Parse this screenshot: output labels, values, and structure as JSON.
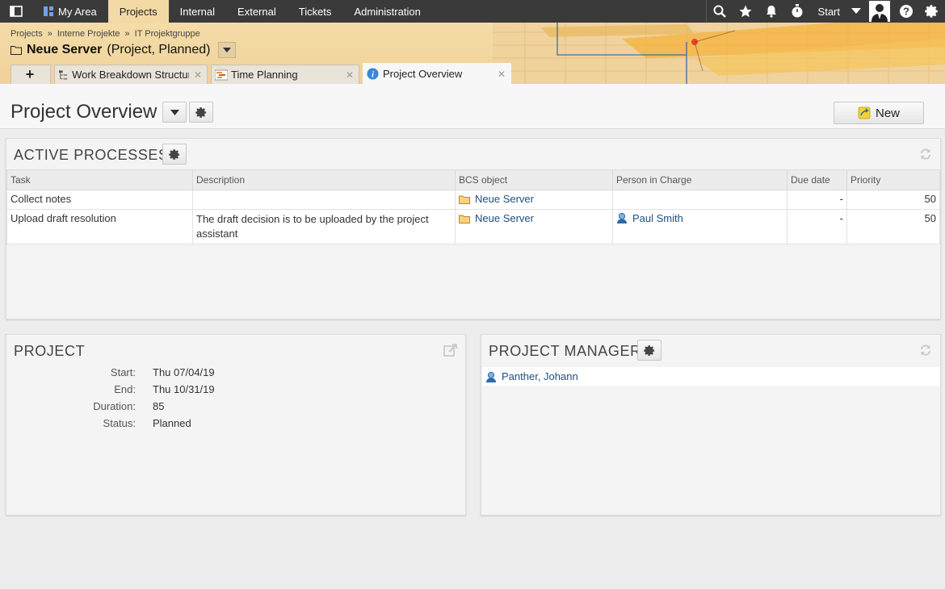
{
  "topnav": {
    "items": [
      "My Area",
      "Projects",
      "Internal",
      "External",
      "Tickets",
      "Administration"
    ],
    "active_index": 1,
    "start_label": "Start"
  },
  "header": {
    "breadcrumb": [
      "Projects",
      "Interne Projekte",
      "IT Projektgruppe"
    ],
    "breadcrumb_separator": "»",
    "project_name": "Neue Server",
    "project_meta": "(Project, Planned)",
    "tabs": [
      {
        "label": "Work Breakdown Structure"
      },
      {
        "label": "Time Planning"
      },
      {
        "label": "Project Overview"
      }
    ],
    "add_tab_label": "+"
  },
  "page": {
    "title": "Project Overview",
    "new_button_label": "New"
  },
  "active_processes": {
    "title": "ACTIVE PROCESSES",
    "columns": [
      "Task",
      "Description",
      "BCS object",
      "Person in Charge",
      "Due date",
      "Priority"
    ],
    "rows": [
      {
        "task": "Collect notes",
        "description": "",
        "bcs_object": "Neue Server",
        "person": "",
        "due": "-",
        "priority": "50"
      },
      {
        "task": "Upload draft resolution",
        "description": "The draft decision is to be uploaded by the project assistant",
        "bcs_object": "Neue Server",
        "person": "Paul Smith",
        "due": "-",
        "priority": "50"
      }
    ]
  },
  "project": {
    "title": "PROJECT",
    "fields": [
      {
        "label": "Start:",
        "value": "Thu 07/04/19"
      },
      {
        "label": "End:",
        "value": "Thu 10/31/19"
      },
      {
        "label": "Duration:",
        "value": "85"
      },
      {
        "label": "Status:",
        "value": "Planned"
      }
    ]
  },
  "project_manager": {
    "title": "PROJECT MANAGER",
    "name": "Panther, Johann"
  },
  "colors": {
    "topnav_bg": "#3a3a3a",
    "header_bg": "#f0d29a",
    "active_nav_bg": "#f3d9a3",
    "link": "#1f4f82"
  }
}
